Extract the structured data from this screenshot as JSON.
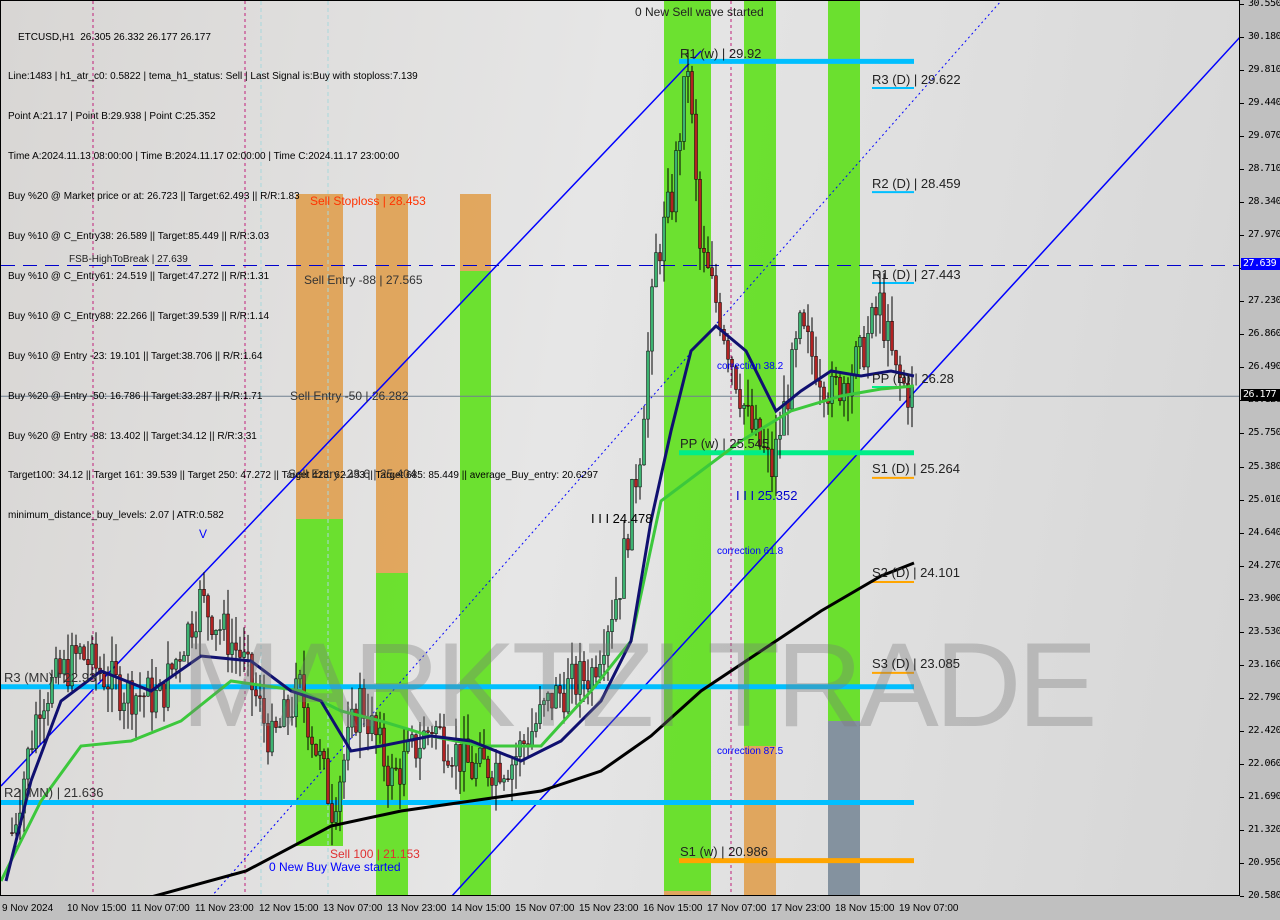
{
  "info": {
    "symbol_line": "ETCUSD,H1  26.305 26.332 26.177 26.177",
    "lines": [
      "Line:1483 | h1_atr_c0: 0.5822 | tema_h1_status: Sell | Last Signal is:Buy with stoploss:7.139",
      "Point A:21.17 | Point B:29.938 | Point C:25.352",
      "Time A:2024.11.13 08:00:00 | Time B:2024.11.17 02:00:00 | Time C:2024.11.17 23:00:00",
      "Buy %20 @ Market price or at: 26.723 || Target:62.493 || R/R:1.83",
      "Buy %10 @ C_Entry38: 26.589 || Target:85.449 || R/R:3.03",
      "Buy %10 @ C_Entry61: 24.519 || Target:47.272 || R/R:1.31",
      "Buy %10 @ C_Entry88: 22.266 || Target:39.539 || R/R:1.14",
      "Buy %10 @ Entry -23: 19.101 || Target:38.706 || R/R:1.64",
      "Buy %20 @ Entry -50: 16.786 || Target:33.287 || R/R:1.71",
      "Buy %20 @ Entry -88: 13.402 || Target:34.12 || R/R:3.31",
      "Target100: 34.12 || Target 161: 39.539 || Target 250: 47.272 || Target 423: 62.493 || Target 685: 85.449 || average_Buy_entry: 20.6297",
      "minimum_distance_buy_levels: 2.07 | ATR:0.582"
    ]
  },
  "labels": {
    "sell_wave": "0 New Sell wave started",
    "buy_wave": "0 New Buy Wave started",
    "r1w": "R1 (w) | 29.92",
    "ppw": "PP (w) | 25.545",
    "s1w": "S1 (w) | 20.986",
    "r3d": "R3 (D) | 29.622",
    "r2d": "R2 (D) | 28.459",
    "r1d": "R1 (D) | 27.443",
    "ppd": "PP (D) | 26.28",
    "s1d": "S1 (D) | 25.264",
    "s2d": "S2 (D) | 24.101",
    "s3d": "S3 (D) | 23.085",
    "r3mn": "R3 (MN) | 22.93",
    "r2mn": "R2 (MN) | 21.636",
    "fsb": "FSB-HighToBreak | 27.639",
    "sell_stoploss": "Sell Stoploss | 28.453",
    "sell_entry_88": "Sell Entry -88 | 27.565",
    "sell_entry_50": "Sell Entry -50 | 26.282",
    "sell_entry_23": "Sell Entry -23.6 | 25.404",
    "sell_100": "Sell 100 | 21.153",
    "wave_b": "I I I 24.478",
    "wave_c": "I I I 25.352",
    "corr38": "correction 38.2",
    "corr61": "correction 61.8",
    "corr87": "correction 87.5",
    "v_mark": "V",
    "watermark": "MARKTZI TRADE"
  },
  "axis": {
    "price_ticks": [
      "30.550",
      "30.180",
      "29.810",
      "29.440",
      "29.070",
      "28.710",
      "28.340",
      "27.970",
      "27.600",
      "27.230",
      "26.860",
      "26.490",
      "26.120",
      "25.750",
      "25.380",
      "25.010",
      "24.640",
      "24.270",
      "23.900",
      "23.530",
      "23.160",
      "22.790",
      "22.420",
      "22.060",
      "21.690",
      "21.320",
      "20.950",
      "20.580"
    ],
    "fsb_tag": "27.639",
    "current_tag": "26.177",
    "time_ticks": [
      "9 Nov 2024",
      "10 Nov 15:00",
      "11 Nov 07:00",
      "11 Nov 23:00",
      "12 Nov 15:00",
      "13 Nov 07:00",
      "13 Nov 23:00",
      "14 Nov 15:00",
      "15 Nov 07:00",
      "15 Nov 23:00",
      "16 Nov 15:00",
      "17 Nov 07:00",
      "17 Nov 23:00",
      "18 Nov 15:00",
      "19 Nov 07:00"
    ]
  },
  "colors": {
    "level_resistance": "#00bfff",
    "level_pivot": "#00ee88",
    "level_support": "#ffa500",
    "band_green": "#5ee01c",
    "band_orange": "#e0a050",
    "channel": "#0000ff",
    "ma_fast": "#101070",
    "ma_mid": "#3cc83c",
    "ma_slow": "#000000",
    "candle_up": "#3cb371",
    "candle_down": "#b22222"
  },
  "chart_data": {
    "type": "line",
    "title": "ETCUSD,H1",
    "ylim": [
      20.58,
      30.55
    ],
    "grid": false,
    "x": [
      "2024-11-10 01:00",
      "2024-11-10 08:00",
      "2024-11-10 18:00",
      "2024-11-11 04:00",
      "2024-11-11 14:00",
      "2024-11-12 00:00",
      "2024-11-12 10:00",
      "2024-11-12 18:00",
      "2024-11-13 01:00",
      "2024-11-13 09:00",
      "2024-11-13 16:00",
      "2024-11-14 00:00",
      "2024-11-14 10:00",
      "2024-11-14 20:00",
      "2024-11-15 06:00",
      "2024-11-15 16:00",
      "2024-11-16 02:00",
      "2024-11-16 09:00",
      "2024-11-16 14:00",
      "2024-11-16 18:00",
      "2024-11-16 22:00",
      "2024-11-17 02:00",
      "2024-11-17 05:00",
      "2024-11-17 10:00",
      "2024-11-17 17:00",
      "2024-11-17 23:00",
      "2024-11-18 06:00",
      "2024-11-18 14:00",
      "2024-11-18 21:00",
      "2024-11-19 02:00",
      "2024-11-19 06:00",
      "2024-11-19 10:00"
    ],
    "series": [
      {
        "values": [
          21.3,
          22.8,
          23.3,
          22.9,
          22.8,
          23.9,
          23.3,
          22.3,
          22.9,
          21.6,
          22.8,
          21.9,
          22.5,
          22.0,
          22.1,
          22.8,
          23.1,
          24.1,
          25.6,
          27.7,
          28.4,
          29.9,
          27.8,
          27.1,
          25.9,
          25.35,
          26.9,
          26.2,
          26.6,
          27.2,
          26.4,
          26.177
        ]
      }
    ],
    "levels": [
      {
        "label_key": "r1w",
        "price": 29.92,
        "color": "#00bfff",
        "scope": "weekly"
      },
      {
        "label_key": "ppw",
        "price": 25.545,
        "color": "#00ee88",
        "scope": "weekly"
      },
      {
        "label_key": "s1w",
        "price": 20.986,
        "color": "#ffa500",
        "scope": "weekly"
      },
      {
        "label_key": "r3d",
        "price": 29.622,
        "color": "#00bfff",
        "scope": "daily"
      },
      {
        "label_key": "r2d",
        "price": 28.459,
        "color": "#00bfff",
        "scope": "daily"
      },
      {
        "label_key": "r1d",
        "price": 27.443,
        "color": "#00bfff",
        "scope": "daily"
      },
      {
        "label_key": "ppd",
        "price": 26.28,
        "color": "#00ee88",
        "scope": "daily"
      },
      {
        "label_key": "s1d",
        "price": 25.264,
        "color": "#ffa500",
        "scope": "daily"
      },
      {
        "label_key": "s2d",
        "price": 24.101,
        "color": "#ffa500",
        "scope": "daily"
      },
      {
        "label_key": "s3d",
        "price": 23.085,
        "color": "#ffa500",
        "scope": "daily"
      },
      {
        "label_key": "r3mn",
        "price": 22.93,
        "color": "#00bfff",
        "scope": "monthly"
      },
      {
        "label_key": "r2mn",
        "price": 21.636,
        "color": "#00bfff",
        "scope": "monthly"
      }
    ],
    "fsb_high_to_break": 27.639,
    "current_price": 26.177
  }
}
